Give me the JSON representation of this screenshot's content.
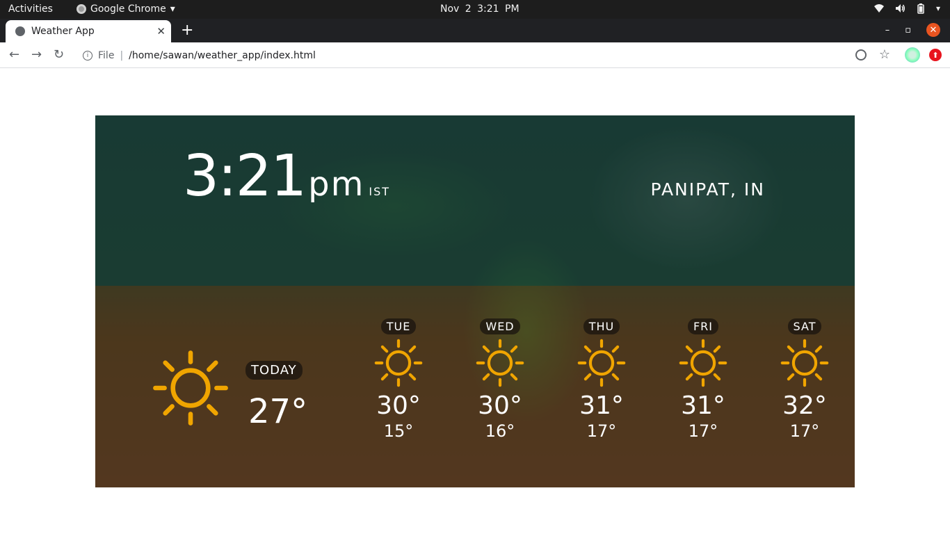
{
  "system_bar": {
    "activities": "Activities",
    "app_name": "Google Chrome",
    "clock": "Nov 2  3:21 PM"
  },
  "browser": {
    "tab_title": "Weather App",
    "new_tab": "+",
    "tab_close": "✕",
    "address_scheme": "File",
    "address_path": "/home/sawan/weather_app/index.html"
  },
  "weather": {
    "time": "3:21",
    "ampm": "pm",
    "timezone": "IST",
    "location": "PANIPAT, IN",
    "today": {
      "label": "TODAY",
      "temp": "27°",
      "icon": "sun-icon"
    },
    "forecast": [
      {
        "day": "TUE",
        "hi": "30°",
        "lo": "15°",
        "icon": "sun-icon"
      },
      {
        "day": "WED",
        "hi": "30°",
        "lo": "16°",
        "icon": "sun-icon"
      },
      {
        "day": "THU",
        "hi": "31°",
        "lo": "17°",
        "icon": "sun-icon"
      },
      {
        "day": "FRI",
        "hi": "31°",
        "lo": "17°",
        "icon": "sun-icon"
      },
      {
        "day": "SAT",
        "hi": "32°",
        "lo": "17°",
        "icon": "sun-icon"
      }
    ],
    "sun_color": "#f0a500"
  }
}
